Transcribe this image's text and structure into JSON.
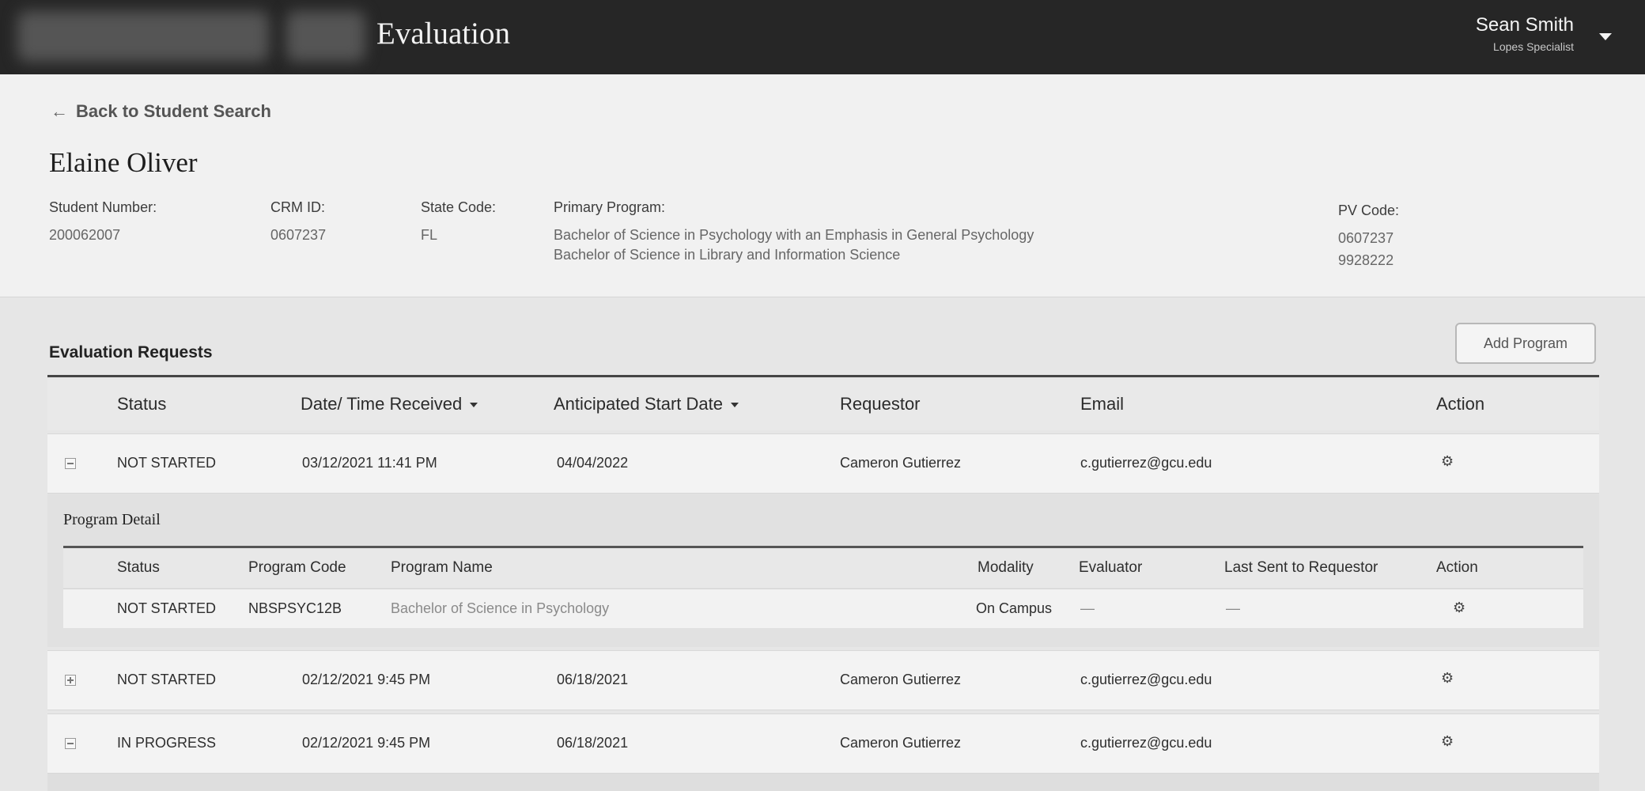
{
  "header": {
    "app_title": "Evaluation",
    "user_name": "Sean Smith",
    "user_role": "Lopes Specialist"
  },
  "student": {
    "back_link": "Back to Student Search",
    "name": "Elaine Oliver",
    "student_number_label": "Student Number:",
    "student_number": "200062007",
    "crm_id_label": "CRM ID:",
    "crm_id": "0607237",
    "state_code_label": "State Code:",
    "state_code": "FL",
    "primary_program_label": "Primary Program:",
    "primary_programs": [
      "Bachelor of  Science in Psychology with an Emphasis in General Psychology",
      "Bachelor of  Science in Library and Information Science"
    ],
    "pv_code_label": "PV Code:",
    "pv_codes": [
      "0607237",
      "9928222"
    ]
  },
  "requests": {
    "title": "Evaluation Requests",
    "add_button": "Add Program",
    "columns": {
      "status": "Status",
      "date_received": "Date/ Time Received",
      "start_date": "Anticipated Start Date",
      "requestor": "Requestor",
      "email": "Email",
      "action": "Action"
    },
    "rows": [
      {
        "status": "NOT STARTED",
        "date_received": "03/12/2021 11:41 PM",
        "start_date": "04/04/2022",
        "requestor": "Cameron Gutierrez",
        "email": "c.gutierrez@gcu.edu",
        "expanded": true
      },
      {
        "status": "NOT STARTED",
        "date_received": "02/12/2021 9:45 PM",
        "start_date": "06/18/2021",
        "requestor": "Cameron Gutierrez",
        "email": "c.gutierrez@gcu.edu",
        "expanded": false
      },
      {
        "status": "IN PROGRESS",
        "date_received": "02/12/2021 9:45 PM",
        "start_date": "06/18/2021",
        "requestor": "Cameron Gutierrez",
        "email": "c.gutierrez@gcu.edu",
        "expanded": true
      }
    ],
    "program_detail": {
      "title": "Program Detail",
      "columns": {
        "status": "Status",
        "program_code": "Program Code",
        "program_name": "Program Name",
        "modality": "Modality",
        "evaluator": "Evaluator",
        "last_sent": "Last Sent to Requestor",
        "action": "Action"
      },
      "row": {
        "status": "NOT STARTED",
        "program_code": "NBSPSYC12B",
        "program_name": "Bachelor of Science in Psychology",
        "modality": "On Campus",
        "evaluator": "—",
        "last_sent": "—"
      }
    }
  }
}
